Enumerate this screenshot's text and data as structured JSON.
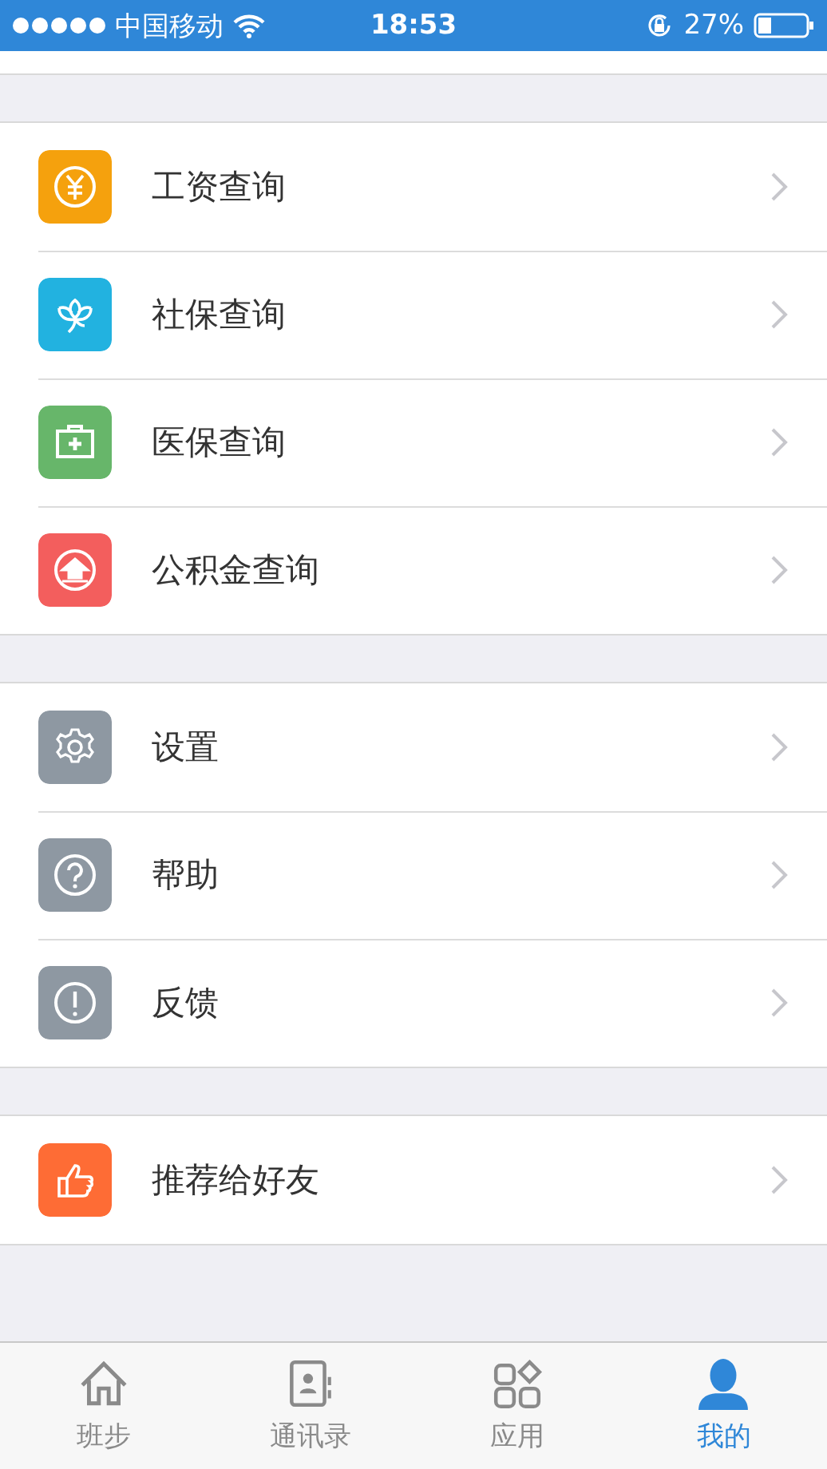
{
  "status_bar": {
    "carrier": "中国移动",
    "time": "18:53",
    "battery": "27%"
  },
  "menu_groups": [
    {
      "items": [
        {
          "label": "工资查询",
          "kind": "yen",
          "color": "#f5a10d"
        },
        {
          "label": "社保查询",
          "kind": "lotus",
          "color": "#22b2e0"
        },
        {
          "label": "医保查询",
          "kind": "medkit",
          "color": "#67b66a"
        },
        {
          "label": "公积金查询",
          "kind": "house",
          "color": "#f35e5d"
        }
      ]
    },
    {
      "items": [
        {
          "label": "设置",
          "kind": "gear",
          "color": "#8e98a2"
        },
        {
          "label": "帮助",
          "kind": "help",
          "color": "#8e98a2"
        },
        {
          "label": "反馈",
          "kind": "alert",
          "color": "#8e98a2"
        }
      ]
    },
    {
      "items": [
        {
          "label": "推荐给好友",
          "kind": "thumb",
          "color": "#fe6c35"
        }
      ]
    }
  ],
  "tab_bar": [
    {
      "label": "班步",
      "kind": "home",
      "selected": false
    },
    {
      "label": "通讯录",
      "kind": "contacts",
      "selected": false
    },
    {
      "label": "应用",
      "kind": "apps",
      "selected": false
    },
    {
      "label": "我的",
      "kind": "person",
      "selected": true
    }
  ]
}
